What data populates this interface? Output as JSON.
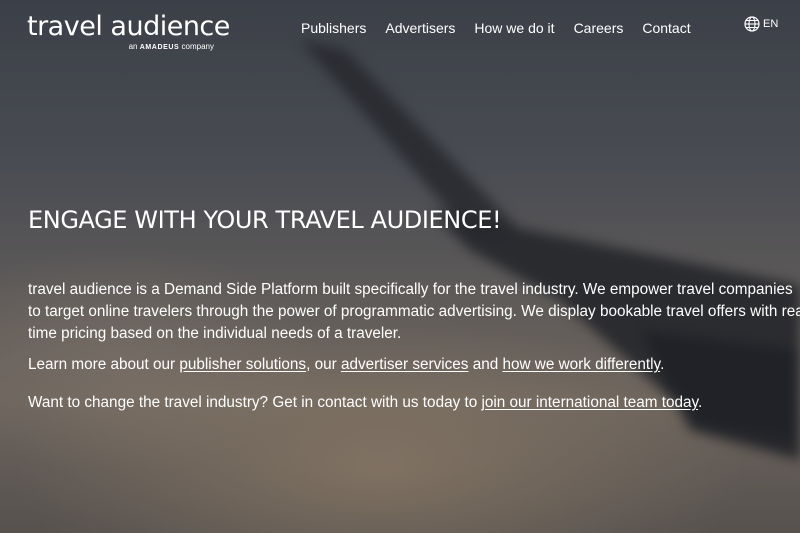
{
  "brand": {
    "name": "travel audience",
    "tagline_prefix": "an",
    "tagline_brand": "AMADEUS",
    "tagline_suffix": "company"
  },
  "nav": {
    "items": [
      {
        "label": "Publishers"
      },
      {
        "label": "Advertisers"
      },
      {
        "label": "How we do it"
      },
      {
        "label": "Careers"
      },
      {
        "label": "Contact"
      }
    ]
  },
  "language": {
    "icon": "globe-icon",
    "label": "EN"
  },
  "hero": {
    "headline": "ENGAGE WITH YOUR TRAVEL AUDIENCE!",
    "intro": "travel audience is a Demand Side Platform built specifically for the travel industry. We empower travel companies to target online travelers through the power of programmatic advertising. We display bookable travel offers with real time pricing based on the individual needs of a traveler.",
    "learn": {
      "prefix": "Learn more about our ",
      "link_publisher": "publisher solutions",
      "sep1": ", our ",
      "link_advertiser": "advertiser services",
      "sep2": " and ",
      "link_how": "how we work differently",
      "end": "."
    },
    "careers": {
      "prefix": "Want to change the travel industry? Get in contact with us today to ",
      "link_join": "join our international team today",
      "end": "."
    }
  },
  "colors": {
    "text": "#ffffff",
    "sky_top": "#4b5058",
    "horizon": "#8e8376"
  }
}
